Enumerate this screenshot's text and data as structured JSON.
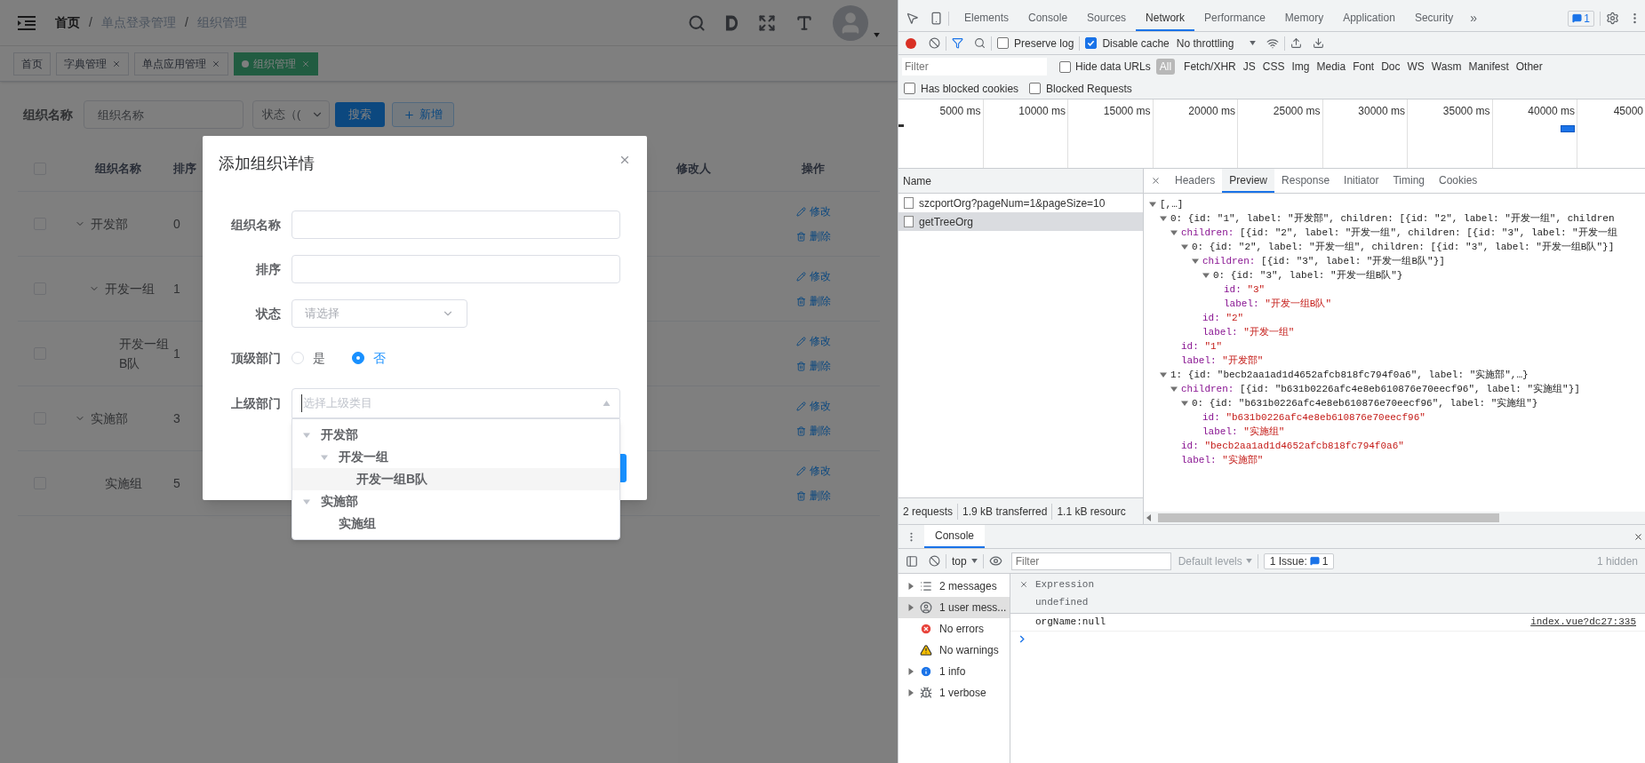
{
  "app": {
    "breadcrumb": [
      {
        "label": "首页",
        "link": true
      },
      {
        "label": "单点登录管理",
        "link": false
      },
      {
        "label": "组织管理",
        "link": false
      }
    ],
    "breadcrumb_separator": "/",
    "tags": [
      {
        "label": "首页",
        "selected": false,
        "closable": false
      },
      {
        "label": "字典管理",
        "selected": false,
        "closable": true
      },
      {
        "label": "单点应用管理",
        "selected": false,
        "closable": true
      },
      {
        "label": "组织管理",
        "selected": true,
        "closable": true
      }
    ],
    "search_form": {
      "label": "组织名称",
      "name_placeholder": "组织名称",
      "status_placeholder": "状态（(",
      "buttons": [
        {
          "label": "搜索",
          "kind": "primary"
        },
        {
          "label": "新增",
          "kind": "add"
        }
      ]
    },
    "table": {
      "all_checked": false,
      "columns": [
        {
          "label": "组织名称",
          "kind": "name"
        },
        {
          "label": "排序",
          "kind": "sort"
        },
        {
          "label": "修改人",
          "kind": "editor"
        },
        {
          "label": "操作",
          "kind": "actions"
        }
      ],
      "rows": [
        {
          "name": "开发部",
          "sort": "0",
          "checked": false,
          "expanded": true,
          "actions": [
            {
              "label": "修改",
              "kind": "edit"
            },
            {
              "label": "删除",
              "kind": "delete"
            }
          ],
          "children": [
            {
              "name": "开发一组",
              "sort": "1",
              "checked": false,
              "expanded": true,
              "actions": [
                {
                  "label": "修改",
                  "kind": "edit"
                },
                {
                  "label": "删除",
                  "kind": "delete"
                }
              ],
              "children": [
                {
                  "name": "开发一组B队",
                  "sort": "1",
                  "checked": false,
                  "actions": [
                    {
                      "label": "修改",
                      "kind": "edit"
                    },
                    {
                      "label": "删除",
                      "kind": "delete"
                    }
                  ]
                }
              ]
            }
          ]
        },
        {
          "name": "实施部",
          "sort": "3",
          "checked": false,
          "expanded": true,
          "actions": [
            {
              "label": "修改",
              "kind": "edit"
            },
            {
              "label": "删除",
              "kind": "delete"
            }
          ],
          "children": [
            {
              "name": "实施组",
              "sort": "5",
              "checked": false,
              "actions": [
                {
                  "label": "修改",
                  "kind": "edit"
                },
                {
                  "label": "删除",
                  "kind": "delete"
                }
              ]
            }
          ]
        }
      ]
    }
  },
  "dialog": {
    "title": "添加组织详情",
    "fields": [
      {
        "kind": "input",
        "label": "组织名称"
      },
      {
        "kind": "input",
        "label": "排序"
      },
      {
        "kind": "select",
        "label": "状态",
        "placeholder": "请选择"
      },
      {
        "kind": "radio",
        "label": "顶级部门",
        "options": [
          {
            "label": "是",
            "selected": false
          },
          {
            "label": "否",
            "selected": true
          }
        ]
      },
      {
        "kind": "treeselect",
        "label": "上级部门",
        "placeholder": "选择上级类目",
        "expanded": true,
        "options": [
          {
            "label": "开发部",
            "expanded": true,
            "children": [
              {
                "label": "开发一组",
                "expanded": true,
                "children": [
                  {
                    "label": "开发一组B队",
                    "highlighted": true
                  }
                ]
              }
            ]
          },
          {
            "label": "实施部",
            "expanded": true,
            "children": [
              {
                "label": "实施组",
                "highlighted": false
              }
            ]
          }
        ]
      }
    ]
  },
  "devtools": {
    "panel_tabs": [
      {
        "label": "Elements",
        "selected": false
      },
      {
        "label": "Console",
        "selected": false
      },
      {
        "label": "Sources",
        "selected": false
      },
      {
        "label": "Network",
        "selected": true
      },
      {
        "label": "Performance",
        "selected": false
      },
      {
        "label": "Memory",
        "selected": false
      },
      {
        "label": "Application",
        "selected": false
      },
      {
        "label": "Security",
        "selected": false
      }
    ],
    "more_tabs": "»",
    "issues_count": "1",
    "toolbar": {
      "preserve_log": {
        "label": "Preserve log",
        "checked": false
      },
      "disable_cache": {
        "label": "Disable cache",
        "checked": true
      },
      "throttling": "No throttling"
    },
    "filter": {
      "placeholder": "Filter",
      "hide_data_urls": {
        "label": "Hide data URLs",
        "checked": false
      },
      "types": [
        {
          "label": "All",
          "selected": true
        },
        {
          "label": "Fetch/XHR",
          "selected": false
        },
        {
          "label": "JS",
          "selected": false
        },
        {
          "label": "CSS",
          "selected": false
        },
        {
          "label": "Img",
          "selected": false
        },
        {
          "label": "Media",
          "selected": false
        },
        {
          "label": "Font",
          "selected": false
        },
        {
          "label": "Doc",
          "selected": false
        },
        {
          "label": "WS",
          "selected": false
        },
        {
          "label": "Wasm",
          "selected": false
        },
        {
          "label": "Manifest",
          "selected": false
        },
        {
          "label": "Other",
          "selected": false
        }
      ]
    },
    "blocked": [
      {
        "label": "Has blocked cookies",
        "checked": false
      },
      {
        "label": "Blocked Requests",
        "checked": false
      }
    ],
    "timeline_ticks": [
      "5000 ms",
      "10000 ms",
      "15000 ms",
      "20000 ms",
      "25000 ms",
      "30000 ms",
      "35000 ms",
      "40000 ms",
      "45000"
    ],
    "requests": {
      "header": "Name",
      "rows": [
        {
          "name": "szcportOrg?pageNum=1&pageSize=10",
          "selected": false
        },
        {
          "name": "getTreeOrg",
          "selected": true
        }
      ],
      "summary": [
        "2 requests",
        "1.9 kB transferred",
        "1.1 kB resourc"
      ]
    },
    "detail_tabs": [
      {
        "label": "Headers",
        "selected": false
      },
      {
        "label": "Preview",
        "selected": true
      },
      {
        "label": "Response",
        "selected": false
      },
      {
        "label": "Initiator",
        "selected": false
      },
      {
        "label": "Timing",
        "selected": false
      },
      {
        "label": "Cookies",
        "selected": false
      }
    ],
    "preview": {
      "summary": "[,…]",
      "expanded": true,
      "children": [
        {
          "key": "0:",
          "kind": "index",
          "summary": "{id: \"1\", label: \"开发部\", children: [{id: \"2\", label: \"开发一组\", children",
          "expanded": true,
          "children": [
            {
              "key": "children:",
              "kind": "property",
              "summary": "[{id: \"2\", label: \"开发一组\", children: [{id: \"3\", label: \"开发一组",
              "expanded": true,
              "children": [
                {
                  "key": "0:",
                  "kind": "index",
                  "summary": "{id: \"2\", label: \"开发一组\", children: [{id: \"3\", label: \"开发一组B队\"}]",
                  "expanded": true,
                  "children": [
                    {
                      "key": "children:",
                      "kind": "property",
                      "summary": "[{id: \"3\", label: \"开发一组B队\"}]",
                      "expanded": true,
                      "children": [
                        {
                          "key": "0:",
                          "kind": "index",
                          "summary": "{id: \"3\", label: \"开发一组B队\"}",
                          "expanded": true,
                          "children": [
                            {
                              "key": "id:",
                              "value": "\"3\""
                            },
                            {
                              "key": "label:",
                              "value": "\"开发一组B队\""
                            }
                          ]
                        }
                      ]
                    },
                    {
                      "key": "id:",
                      "value": "\"2\""
                    },
                    {
                      "key": "label:",
                      "value": "\"开发一组\""
                    }
                  ]
                }
              ]
            },
            {
              "key": "id:",
              "value": "\"1\""
            },
            {
              "key": "label:",
              "value": "\"开发部\""
            }
          ]
        },
        {
          "key": "1:",
          "kind": "index",
          "summary": "{id: \"becb2aa1ad1d4652afcb818fc794f0a6\", label: \"实施部\",…}",
          "expanded": true,
          "children": [
            {
              "key": "children:",
              "kind": "property",
              "summary": "[{id: \"b631b0226afc4e8eb610876e70eecf96\", label: \"实施组\"}]",
              "expanded": true,
              "children": [
                {
                  "key": "0:",
                  "kind": "index",
                  "summary": "{id: \"b631b0226afc4e8eb610876e70eecf96\", label: \"实施组\"}",
                  "expanded": true,
                  "children": [
                    {
                      "key": "id:",
                      "value": "\"b631b0226afc4e8eb610876e70eecf96\""
                    },
                    {
                      "key": "label:",
                      "value": "\"实施组\""
                    }
                  ]
                }
              ]
            },
            {
              "key": "id:",
              "value": "\"becb2aa1ad1d4652afcb818fc794f0a6\""
            },
            {
              "key": "label:",
              "value": "\"实施部\""
            }
          ]
        }
      ]
    },
    "drawer": {
      "tab": {
        "label": "Console",
        "selected": true
      },
      "context": "top",
      "filter_placeholder": "Filter",
      "levels": "Default levels",
      "issues": {
        "label": "1 Issue:",
        "count": "1"
      },
      "hidden": "1 hidden",
      "sidebar": [
        {
          "label": "2 messages",
          "kind": "messages",
          "expandable": true,
          "selected": false
        },
        {
          "label": "1 user mess...",
          "kind": "user",
          "expandable": true,
          "selected": true
        },
        {
          "label": "No errors",
          "kind": "error",
          "expandable": false,
          "selected": false
        },
        {
          "label": "No warnings",
          "kind": "warning",
          "expandable": false,
          "selected": false
        },
        {
          "label": "1 info",
          "kind": "info",
          "expandable": true,
          "selected": false
        },
        {
          "label": "1 verbose",
          "kind": "verbose",
          "expandable": true,
          "selected": false
        }
      ],
      "messages": [
        {
          "kind": "expression",
          "label": "Expression",
          "result": "undefined"
        },
        {
          "kind": "log",
          "text": "orgName:null",
          "source": "index.vue?dc27:335"
        }
      ]
    }
  }
}
